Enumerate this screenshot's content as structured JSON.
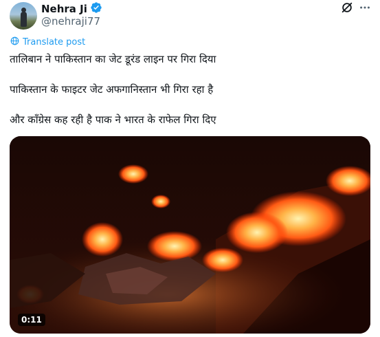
{
  "author": {
    "display_name": "Nehra Ji",
    "handle": "@nehraji77",
    "verified": true
  },
  "icons": {
    "verified": "verified-badge-icon",
    "grok": "grok-icon",
    "more": "more-icon",
    "translate": "globe-icon"
  },
  "translate_label": "Translate post",
  "post": {
    "lines": [
      "तालिबान ने पाकिस्तान का जेट डूरंड लाइन पर गिरा दिया",
      "पाकिस्तान के फाइटर जेट अफगानिस्तान भी गिरा रहा है",
      "और कॉंग्रेस कह रही है पाक ने भारत के राफेल गिरा दिए"
    ]
  },
  "media": {
    "type": "video",
    "duration": "0:11"
  },
  "colors": {
    "accent": "#1d9bf0",
    "text": "#0f1419",
    "secondary": "#536471"
  }
}
